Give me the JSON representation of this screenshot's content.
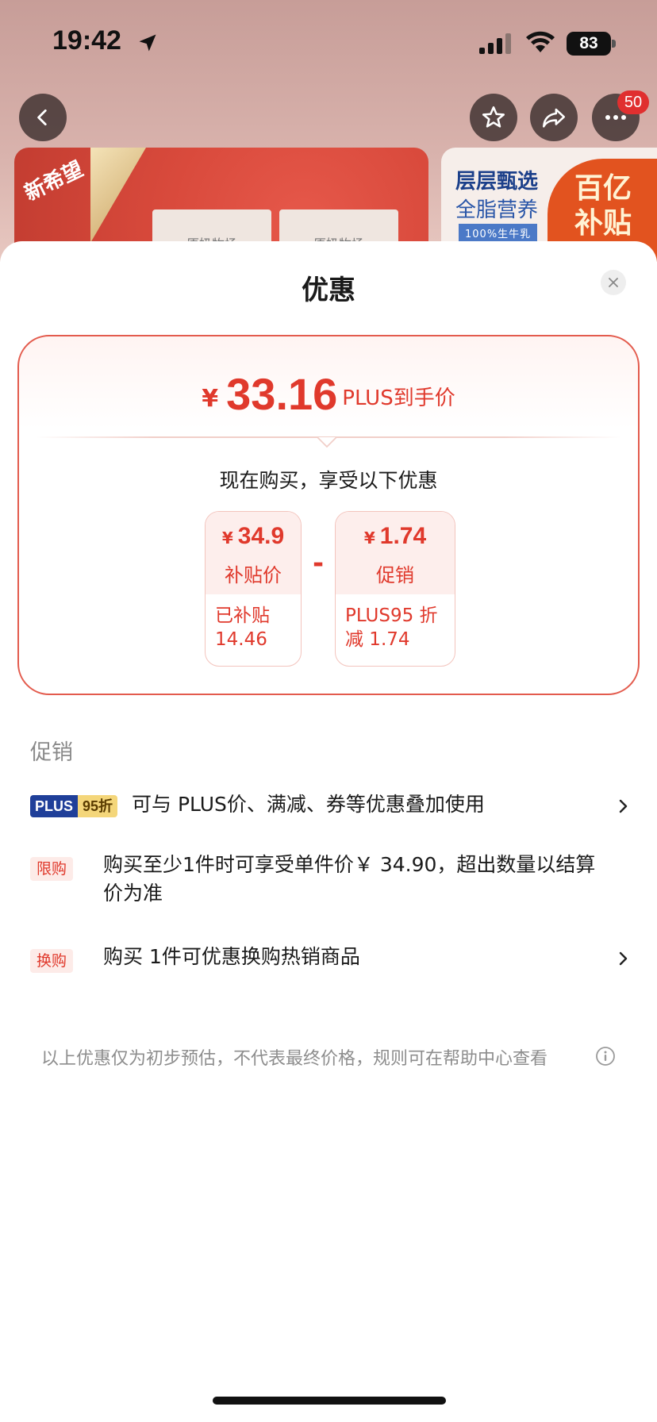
{
  "status_bar": {
    "time": "19:42",
    "battery": "83"
  },
  "nav": {
    "more_badge": "50"
  },
  "background_banner": {
    "left_tag": "新希望",
    "left_card_1": "原奶牧场",
    "left_card_2": "原奶牧场",
    "right_title": "层层甄选",
    "right_subtitle": "全脂营养",
    "right_tag": "100%生牛乳",
    "right_badge_line1": "百亿",
    "right_badge_line2": "补贴"
  },
  "sheet": {
    "title": "优惠",
    "price_card": {
      "currency": "¥",
      "final_price": "33.16",
      "final_label": "PLUS到手价",
      "buy_text": "现在购买，享受以下优惠",
      "minus": "-",
      "items": [
        {
          "currency": "¥",
          "value": "34.9",
          "label": "补贴价",
          "detail_line1": "已补贴",
          "detail_line2": "14.46"
        },
        {
          "currency": "¥",
          "value": "1.74",
          "label": "促销",
          "detail_line1": "PLUS95 折",
          "detail_line2": "减 1.74"
        }
      ]
    },
    "section_label": "促销",
    "promotions": [
      {
        "tag_a": "PLUS",
        "tag_b": "95折",
        "text": "可与 PLUS价、满减、券等优惠叠加使用"
      },
      {
        "tag": "限购",
        "text": "购买至少1件时可享受单件价￥ 34.90，超出数量以结算价为准"
      },
      {
        "tag": "换购",
        "text": "购买 1件可优惠换购热销商品"
      }
    ],
    "footnote": "以上优惠仅为初步预估，不代表最终价格，规则可在帮助中心查看"
  },
  "colors": {
    "accent_red": "#e0392c",
    "card_border": "#e35b4d",
    "plus_blue": "#1f3f99",
    "plus_gold": "#f4d67a"
  }
}
